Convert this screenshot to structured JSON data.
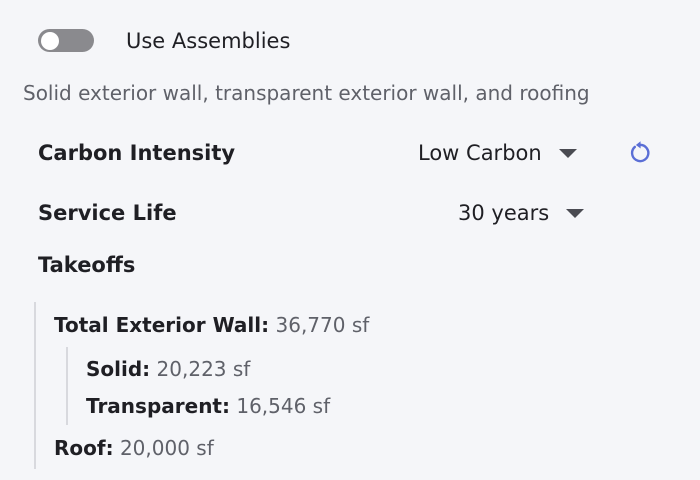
{
  "assemblies": {
    "toggle_on": false,
    "label": "Use Assemblies"
  },
  "description": "Solid exterior wall, transparent exterior wall, and roofing",
  "carbon_intensity": {
    "label": "Carbon Intensity",
    "value": "Low Carbon",
    "reset_icon": "reset-icon"
  },
  "service_life": {
    "label": "Service Life",
    "value": "30 years"
  },
  "takeoffs": {
    "title": "Takeoffs",
    "total_wall": {
      "label": "Total Exterior Wall:",
      "value": "36,770 sf"
    },
    "solid": {
      "label": "Solid:",
      "value": "20,223 sf"
    },
    "transparent": {
      "label": "Transparent:",
      "value": "16,546 sf"
    },
    "roof": {
      "label": "Roof:",
      "value": "20,000 sf"
    }
  },
  "colors": {
    "accent": "#5b6fd6",
    "toggle_off": "#8a8a8e"
  }
}
